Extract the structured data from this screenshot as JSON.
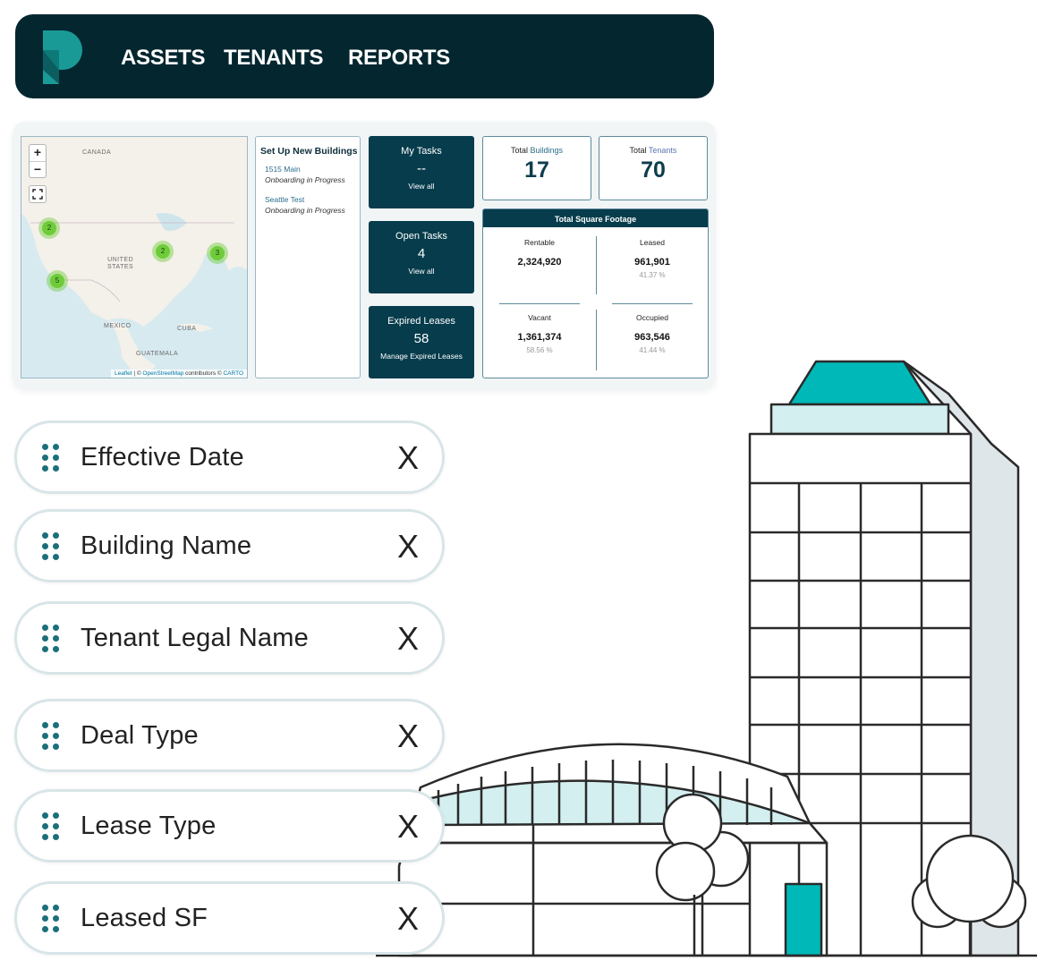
{
  "nav": {
    "links": [
      "ASSETS",
      "TENANTS",
      "REPORTS"
    ]
  },
  "map": {
    "labels": {
      "canada": "CANADA",
      "united_states": "UNITED\nSTATES",
      "mexico": "MEXICO",
      "cuba": "CUBA",
      "guatemala": "GUATEMALA"
    },
    "clusters": [
      "2",
      "2",
      "3",
      "5"
    ],
    "zoom_in": "+",
    "zoom_out": "−",
    "attribution": {
      "leaflet": "Leaflet",
      "sep1": " | © ",
      "osm": "OpenStreetMap",
      "contrib": " contributors © ",
      "carto": "CARTO"
    }
  },
  "setup": {
    "title": "Set Up New Buildings",
    "items": [
      {
        "name": "1515 Main",
        "status": "Onboarding in Progress"
      },
      {
        "name": "Seattle Test",
        "status": "Onboarding in Progress"
      }
    ]
  },
  "tasks": [
    {
      "title": "My Tasks",
      "value": "--",
      "link": "View all"
    },
    {
      "title": "Open Tasks",
      "value": "4",
      "link": "View all"
    },
    {
      "title": "Expired Leases",
      "value": "58",
      "link": "Manage Expired Leases"
    }
  ],
  "stats": {
    "buildings": {
      "prefix": "Total",
      "word": "Buildings",
      "value": "17"
    },
    "tenants": {
      "prefix": "Total",
      "word": "Tenants",
      "value": "70"
    }
  },
  "sqft": {
    "title": "Total Square Footage",
    "rentable": {
      "label": "Rentable",
      "value": "2,324,920"
    },
    "leased": {
      "label": "Leased",
      "value": "961,901",
      "pct": "41.37 %"
    },
    "vacant": {
      "label": "Vacant",
      "value": "1,361,374",
      "pct": "58.56 %"
    },
    "occupied": {
      "label": "Occupied",
      "value": "963,546",
      "pct": "41.44 %"
    }
  },
  "fields": [
    "Effective Date",
    "Building Name",
    "Tenant Legal Name",
    "Deal Type",
    "Lease Type",
    "Leased SF"
  ],
  "remove_label": "X",
  "colors": {
    "navy": "#03262f",
    "teal": "#00b8b8",
    "cluster": "#6ecc39",
    "link": "#2b6d8a"
  },
  "icons": [
    "logo-icon",
    "drag-handle-icon",
    "fullscreen-icon",
    "close-icon"
  ]
}
